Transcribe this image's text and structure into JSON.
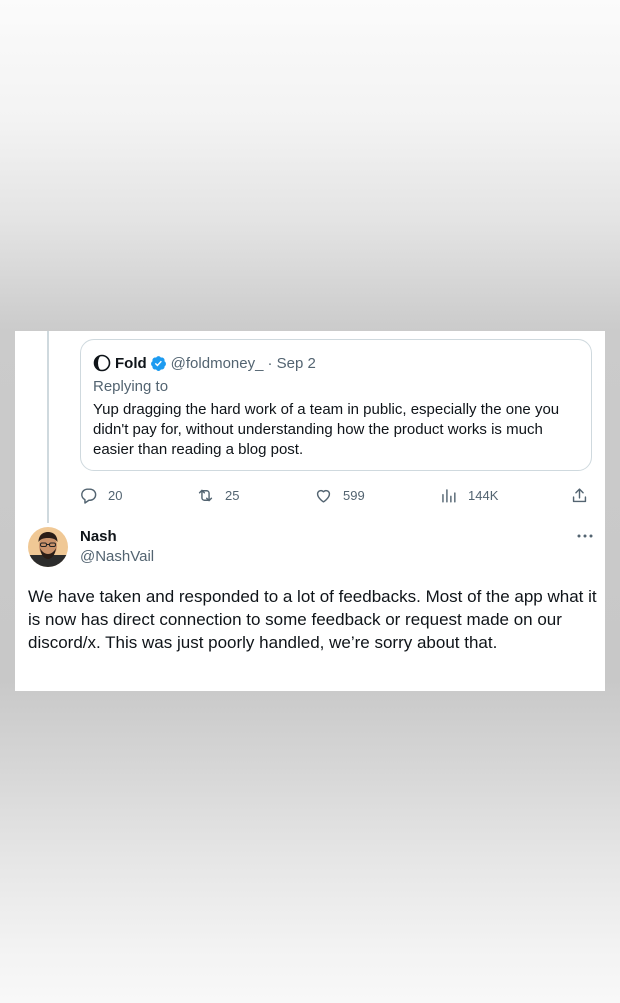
{
  "quoted_tweet": {
    "name": "Fold",
    "handle": "@foldmoney_",
    "date": "· Sep 2",
    "replying_to": "Replying to",
    "text": "Yup dragging the hard work of a team in public, especially the one  you didn't pay for, without understanding how the product works is much easier than reading a blog post.",
    "icons": {
      "logo": "fold-logo-icon",
      "verified": "verified-badge-icon"
    },
    "colors": {
      "verified": "#1d9bf0"
    }
  },
  "actions": {
    "reply_count": "20",
    "retweet_count": "25",
    "like_count": "599",
    "views_count": "144K",
    "icons": [
      "reply-icon",
      "retweet-icon",
      "like-icon",
      "views-icon",
      "share-icon"
    ]
  },
  "tweet": {
    "author_name": "Nash",
    "author_handle": "@NashVail",
    "text": "We have taken and responded to a lot of feedbacks. Most of the app what it is now has direct connection to some feedback or request made on our discord/x. This was just poorly handled, we’re sorry about that.",
    "more_icon": "more-horizontal-icon"
  }
}
